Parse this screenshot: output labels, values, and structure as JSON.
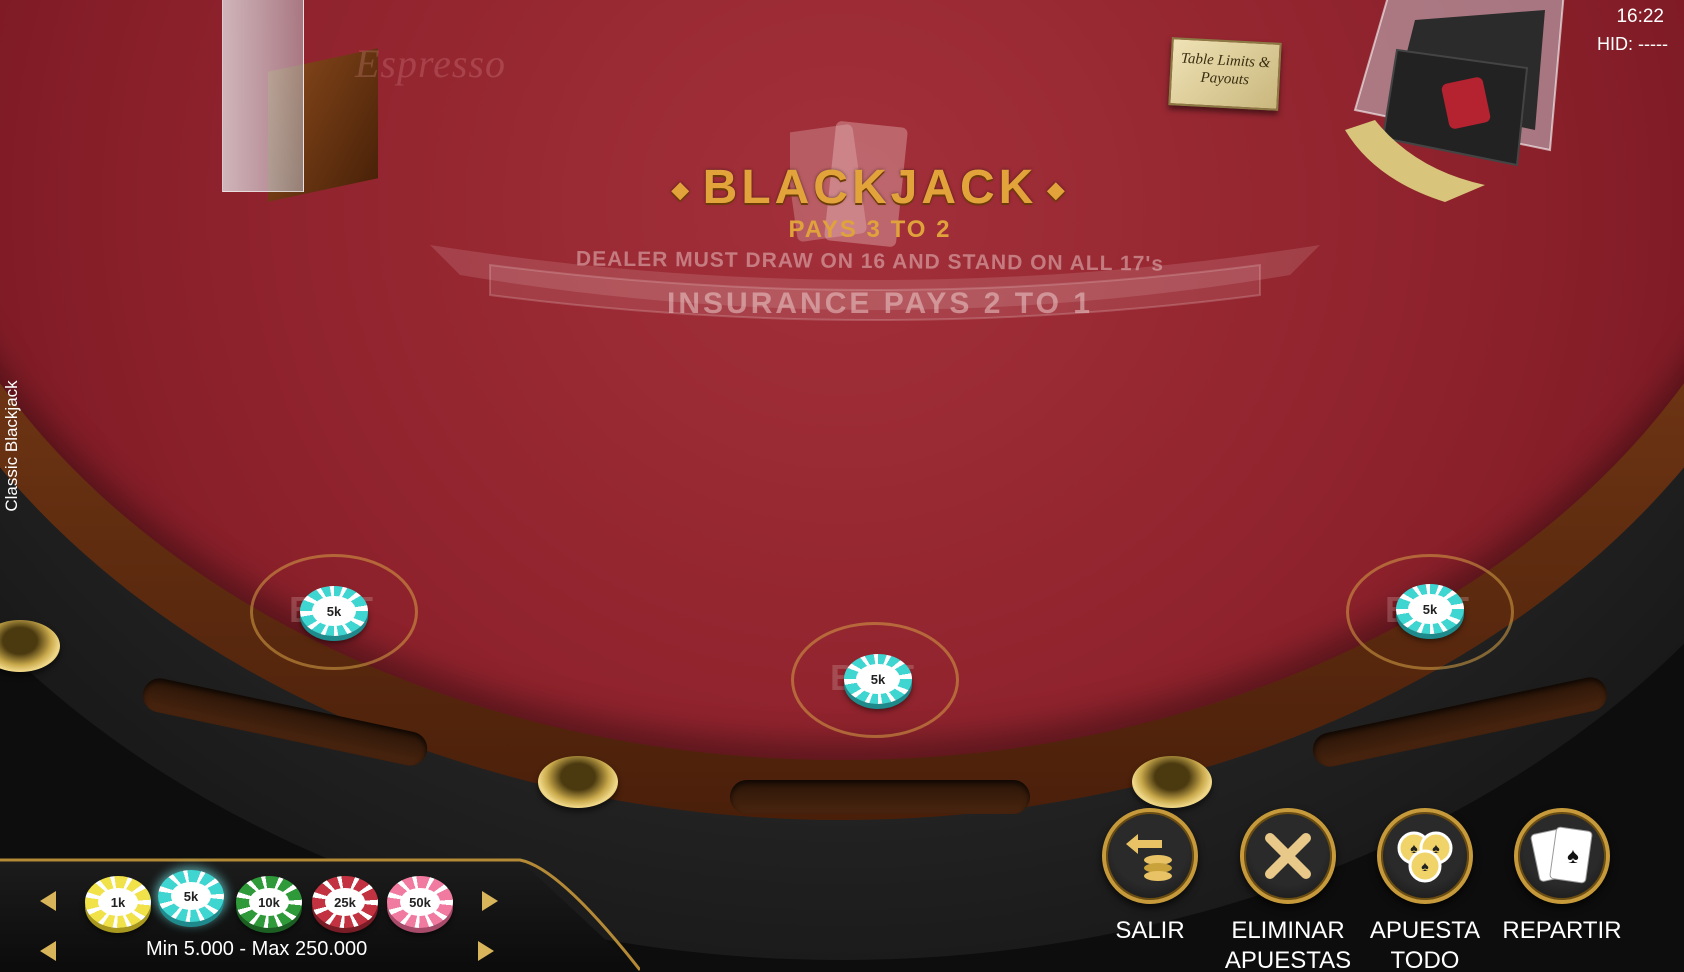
{
  "header": {
    "time": "16:22",
    "hid": "HID: -----",
    "game_title": "Classic Blackjack"
  },
  "table": {
    "brand": "Espresso",
    "title": "BLACKJACK",
    "title_diamond": "◆",
    "subtitle": "PAYS 3 TO 2",
    "rule_dealer": "DEALER MUST DRAW ON 16 AND STAND ON ALL 17's",
    "rule_insurance": "INSURANCE PAYS 2 TO 1",
    "limits_plaque": "Table Limits & Payouts",
    "bet_spot_label": "BET",
    "spots": [
      {
        "chip": "5k"
      },
      {
        "chip": "5k"
      },
      {
        "chip": "5k"
      }
    ]
  },
  "chips": {
    "items": [
      {
        "label": "1k",
        "color": "#f2e24a"
      },
      {
        "label": "5k",
        "color": "#3fd6d2"
      },
      {
        "label": "10k",
        "color": "#2f9a3a"
      },
      {
        "label": "25k",
        "color": "#c23240"
      },
      {
        "label": "50k",
        "color": "#f07aa0"
      }
    ],
    "selected": "5k",
    "limits": "Min  5.000 - Max  250.000"
  },
  "actions": [
    {
      "label": "SALIR",
      "icon": "exit-stack-icon"
    },
    {
      "label": "ELIMINAR APUESTAS",
      "icon": "close-x-icon"
    },
    {
      "label": "APUESTA TODO",
      "icon": "bet-all-chips-icon"
    },
    {
      "label": "REPARTIR",
      "icon": "deal-cards-icon"
    }
  ],
  "colors": {
    "felt": "#8e222c",
    "gold": "#e2a43a",
    "accent": "#c69a3a"
  }
}
